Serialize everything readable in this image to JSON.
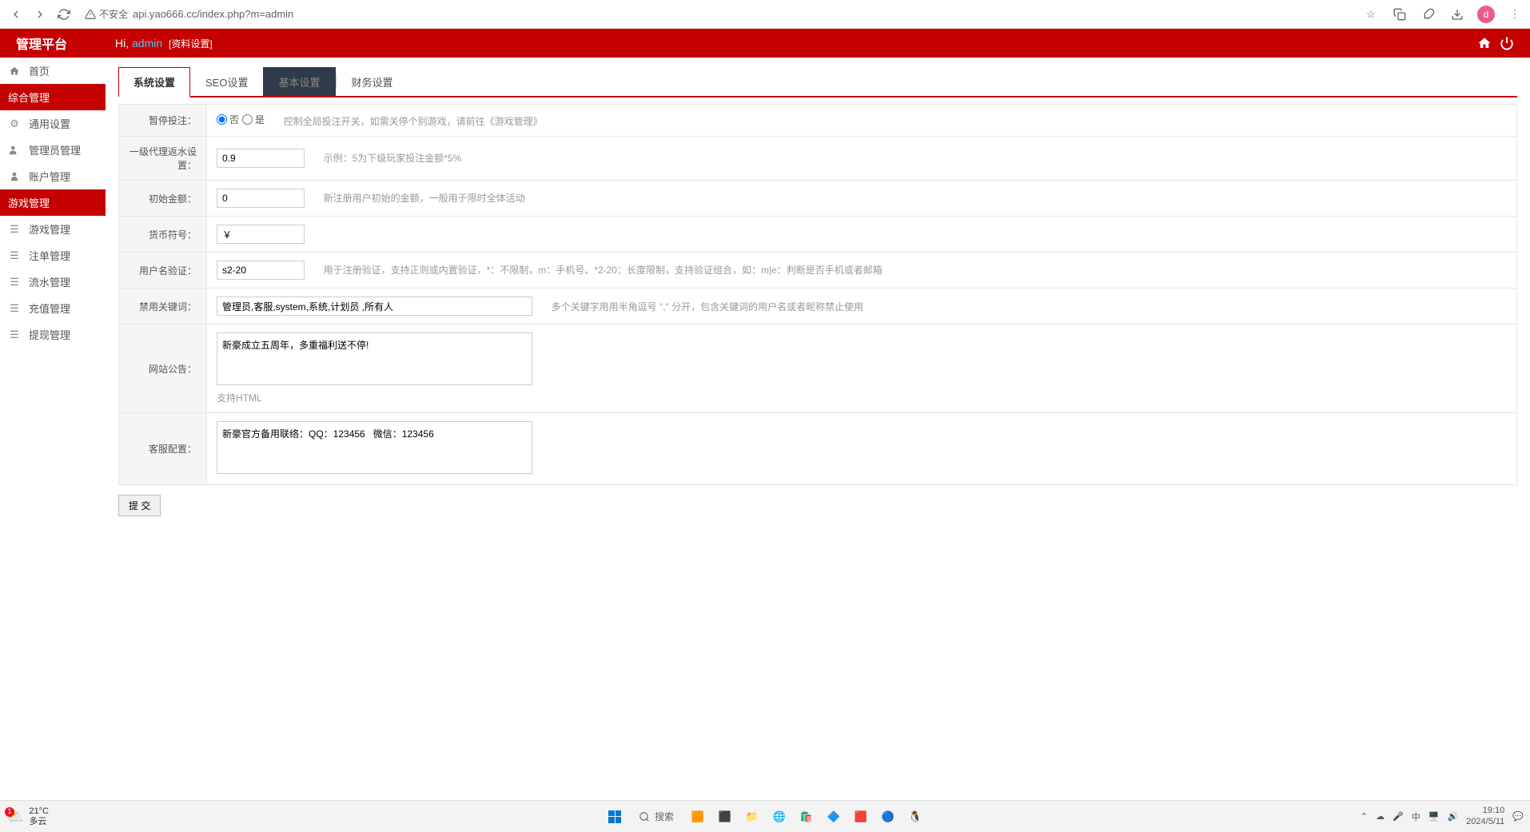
{
  "browser": {
    "url": "api.yao666.cc/index.php?m=admin",
    "security": "不安全"
  },
  "header": {
    "platform": "管理平台",
    "hi": "Hi, ",
    "username": "admin",
    "subtitle": "[资料设置]"
  },
  "sidebar": {
    "items": [
      {
        "label": "首页",
        "header": false
      },
      {
        "label": "综合管理",
        "header": true
      },
      {
        "label": "通用设置",
        "header": false
      },
      {
        "label": "管理员管理",
        "header": false
      },
      {
        "label": "账户管理",
        "header": false
      },
      {
        "label": "游戏管理",
        "header": true
      },
      {
        "label": "游戏管理",
        "header": false
      },
      {
        "label": "注单管理",
        "header": false
      },
      {
        "label": "流水管理",
        "header": false
      },
      {
        "label": "充值管理",
        "header": false
      },
      {
        "label": "提现管理",
        "header": false
      }
    ]
  },
  "tabs": [
    {
      "label": "系统设置",
      "active": true
    },
    {
      "label": "SEO设置"
    },
    {
      "label": "基本设置",
      "dark": true
    },
    {
      "label": "财务设置"
    }
  ],
  "form": {
    "pause_bet": {
      "label": "暂停投注：",
      "no": "否",
      "yes": "是",
      "hint": "控制全局投注开关，如需关停个别游戏，请前往《游戏管理》"
    },
    "agent_rebate": {
      "label": "一级代理返水设置：",
      "value": "0.9",
      "hint": "示例：5为下级玩家投注金额*5%"
    },
    "init_amount": {
      "label": "初始金额：",
      "value": "0",
      "hint": "新注册用户初始的金额，一般用于限时全体活动"
    },
    "currency": {
      "label": "货币符号：",
      "value": "￥"
    },
    "user_verify": {
      "label": "用户名验证：",
      "value": "s2-20",
      "hint": "用于注册验证，支持正则或内置验证，*：不限制，m：手机号、*2-20：长度限制，支持验证组合，如：m|e：判断是否手机或者邮箱"
    },
    "forbidden": {
      "label": "禁用关键词：",
      "value": "管理员,客服,system,系统,计划员 ,所有人",
      "hint": "多个关键字用用半角逗号 \",\" 分开，包含关键词的用户名或者昵称禁止使用"
    },
    "announce": {
      "label": "网站公告：",
      "value": "新豪成立五周年，多重福利送不停!",
      "hint": "支持HTML"
    },
    "service": {
      "label": "客服配置：",
      "value": "新豪官方备用联络：QQ：123456   微信：123456"
    },
    "submit": "提 交"
  },
  "taskbar": {
    "temp": "21°C",
    "weather": "多云",
    "search": "搜索",
    "ime": "中",
    "time": "19:10",
    "date": "2024/5/11"
  }
}
